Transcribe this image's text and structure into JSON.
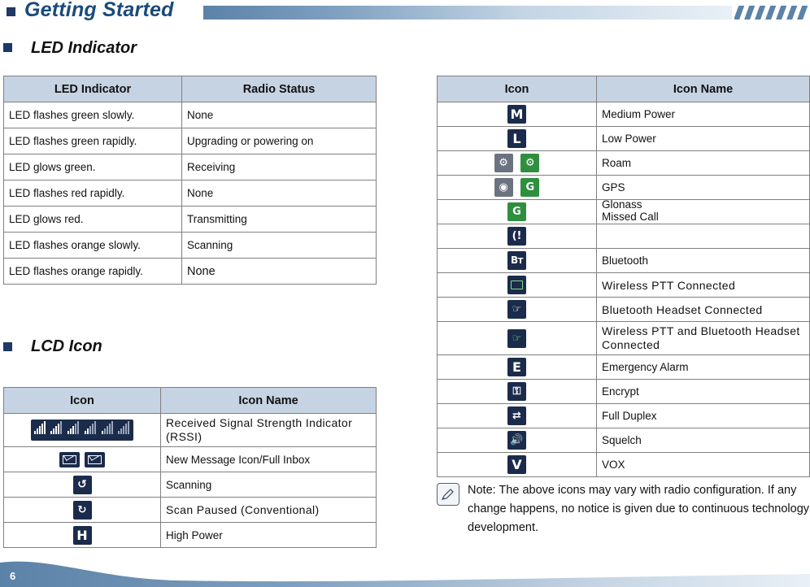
{
  "header": {
    "title": "Getting Started",
    "bullet_color": "#1f3864",
    "bar_color": "#5b82a8"
  },
  "sections": [
    {
      "id": "led",
      "title": "LED Indicator"
    },
    {
      "id": "lcd",
      "title": "LCD Icon"
    }
  ],
  "led_table": {
    "headers": [
      "LED Indicator",
      "Radio Status"
    ],
    "rows": [
      [
        "LED flashes green slowly.",
        "None"
      ],
      [
        "LED flashes green rapidly.",
        "Upgrading or powering on"
      ],
      [
        "LED glows green.",
        "Receiving"
      ],
      [
        "LED flashes red rapidly.",
        "None"
      ],
      [
        "LED glows red.",
        "Transmitting"
      ],
      [
        "LED flashes orange slowly.",
        "Scanning"
      ],
      [
        "LED flashes orange rapidly.",
        "None"
      ]
    ]
  },
  "lcd_table": {
    "headers": [
      "Icon",
      "Icon Name"
    ],
    "rows": [
      {
        "icon": "signal-strength-icon",
        "name": "Received Signal Strength Indicator (RSSI)"
      },
      {
        "icon": "new-message-icon",
        "name": "New Message Icon/Full Inbox"
      },
      {
        "icon": "scanning-icon",
        "name": "Scanning"
      },
      {
        "icon": "scan-paused-icon",
        "name": "Scan Paused (Conventional)"
      },
      {
        "icon": "high-power-icon",
        "name": "High Power"
      }
    ]
  },
  "icon_table": {
    "headers": [
      "Icon",
      "Icon Name"
    ],
    "rows": [
      {
        "icon": "medium-power-icon",
        "name": "Medium Power"
      },
      {
        "icon": "low-power-icon",
        "name": "Low Power"
      },
      {
        "icon": "roam-icon",
        "name": "Roam"
      },
      {
        "icon": "gps-icon",
        "name": "GPS"
      },
      {
        "icon": "glonass-icon",
        "name": "Glonass"
      },
      {
        "icon": "missed-call-icon",
        "name": "Missed Call"
      },
      {
        "icon": "bluetooth-icon",
        "name": "Bluetooth"
      },
      {
        "icon": "wireless-ptt-icon",
        "name": "Wireless PTT Connected"
      },
      {
        "icon": "bluetooth-headset-icon",
        "name": "Bluetooth Headset Connected"
      },
      {
        "icon": "wireless-ptt-bluetooth-headset-icon",
        "name": "Wireless PTT and Bluetooth Headset  Connected"
      },
      {
        "icon": "emergency-alarm-icon",
        "name": "Emergency Alarm"
      },
      {
        "icon": "encrypt-icon",
        "name": "Encrypt"
      },
      {
        "icon": "full-duplex-icon",
        "name": "Full Duplex"
      },
      {
        "icon": "squelch-icon",
        "name": "Squelch"
      },
      {
        "icon": "vox-icon",
        "name": "VOX"
      }
    ]
  },
  "note": {
    "text": "Note: The above icons may vary with radio configuration. If any change happens, no notice is given due to continuous technology development."
  },
  "footer": {
    "page_number": "6"
  }
}
